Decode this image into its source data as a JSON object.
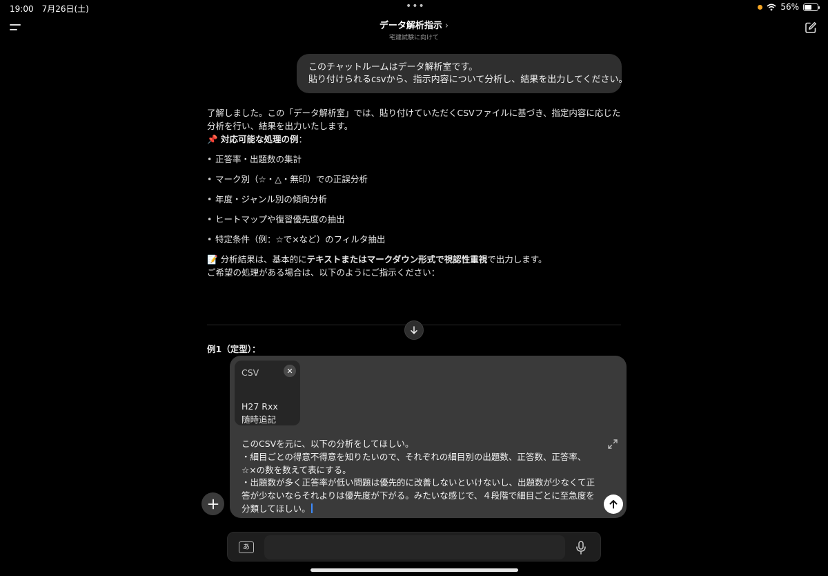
{
  "status_bar": {
    "time_date": "19:00　7月26日(土)",
    "wifi_icon": "wifi-icon",
    "battery_percent": "56%",
    "battery_level": 0.56
  },
  "header": {
    "title": "データ解析指示",
    "chevron": "›",
    "subtitle": "宅建試験に向けて"
  },
  "user_message": {
    "lines": [
      "このチャットルームはデータ解析室です。",
      "貼り付けられるcsvから、指示内容について分析し、結果を出力してください。"
    ]
  },
  "assistant": {
    "intro": "了解しました。この「データ解析室」では、貼り付けていただくCSVファイルに基づき、指定内容に応じた分析を行い、結果を出力いたします。",
    "heading_emoji": "📌",
    "heading": "対応可能な処理の例",
    "heading_colon": "：",
    "bullets": [
      "正答率・出題数の集計",
      "マーク別（☆・△・無印）での正誤分析",
      "年度・ジャンル別の傾向分析",
      "ヒートマップや復習優先度の抽出",
      "特定条件（例：☆で×など）のフィルタ抽出"
    ],
    "note_emoji": "📝",
    "note_prefix": "分析結果は、基本的に",
    "note_bold": "テキストまたはマークダウン形式で視認性重視",
    "note_suffix": "で出力します。",
    "ask": "ご希望の処理がある場合は、以下のようにご指示ください："
  },
  "example_label": "例1（定型）：",
  "composer": {
    "attachment": {
      "type": "CSV",
      "name_line1": "H27 Rxx",
      "name_line2": "随時追記"
    },
    "text": "このCSVを元に、以下の分析をしてほしい。\n・細目ごとの得意不得意を知りたいので、それぞれの細目別の出題数、正答数、正答率、☆×の数を数えて表にする。\n・出題数が多く正答率が低い問題は優先的に改善しないといけないし、出題数が少なくて正答が少ないならそれよりは優先度が下がる。みたいな感じで、４段階で細目ごとに至急度を分類してほしい。"
  },
  "keyboard_bar": {
    "ime_label": "あ"
  }
}
